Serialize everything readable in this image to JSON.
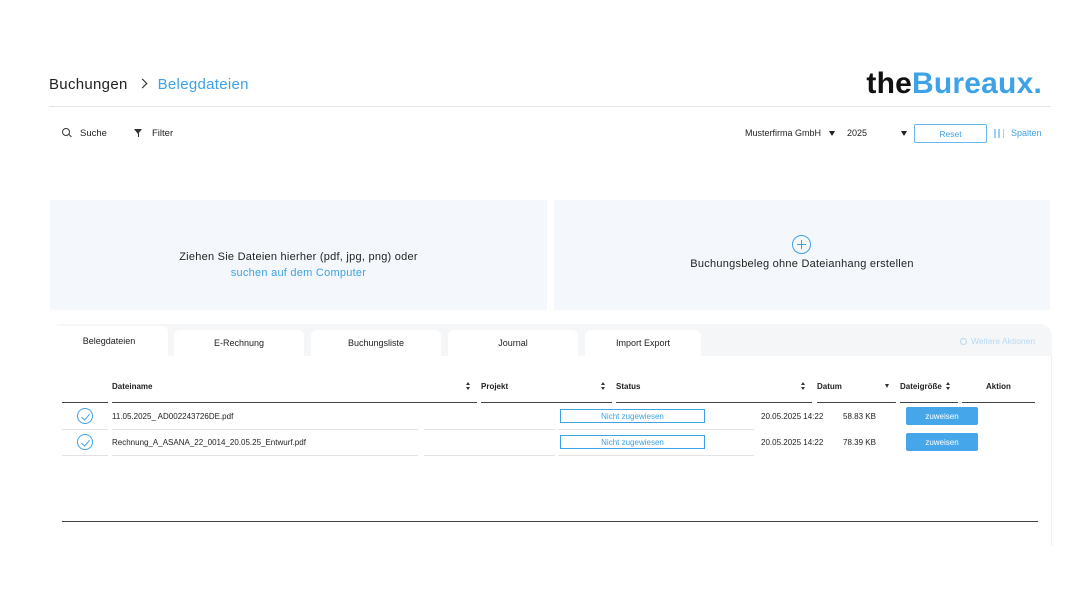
{
  "breadcrumb": {
    "root": "Buchungen",
    "current": "Belegdateien"
  },
  "logo": {
    "part1": "the",
    "part2": "Bureaux."
  },
  "toolbar": {
    "search_label": "Suche",
    "filter_label": "Filter",
    "company_select": "Musterfirma GmbH",
    "year_select": "2025",
    "reset_label": "Reset",
    "columns_label": "Spalten"
  },
  "upload": {
    "drop_text": "Ziehen Sie Dateien hierher (pdf, jpg, png) oder",
    "drop_link": "suchen auf dem Computer",
    "create_text": "Buchungsbeleg ohne Dateianhang erstellen"
  },
  "tabs": [
    "Belegdateien",
    "E-Rechnung",
    "Buchungsliste",
    "Journal",
    "Import Export"
  ],
  "more_actions": "Weitere Aktionen",
  "table": {
    "headers": {
      "filename": "Dateiname",
      "project": "Projekt",
      "status": "Status",
      "date": "Datum",
      "size": "Dateigröße",
      "action": "Aktion"
    },
    "rows": [
      {
        "filename": "11.05.2025_ AD002243726DE.pdf",
        "project": "",
        "status": "Nicht zugewiesen",
        "date": "20.05.2025 14:22",
        "size": "58.83 KB",
        "action": "zuweisen"
      },
      {
        "filename": "Rechnung_A_ASANA_22_0014_20.05.25_Entwurf.pdf",
        "project": "",
        "status": "Nicht zugewiesen",
        "date": "20.05.2025 14:22",
        "size": "78.39 KB",
        "action": "zuweisen"
      }
    ]
  },
  "colors": {
    "accent": "#3da2e6",
    "panel_bg": "#f4f8fc",
    "button_bg": "#45a6ea"
  }
}
